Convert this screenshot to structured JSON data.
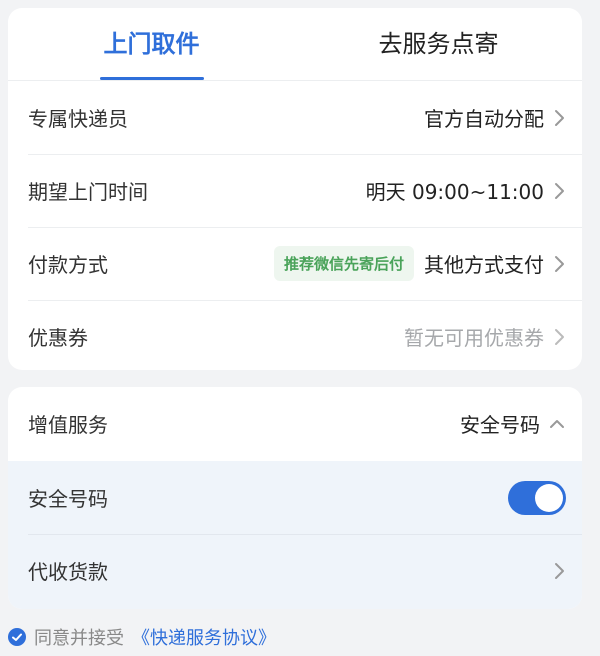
{
  "tabs": [
    {
      "label": "上门取件",
      "active": true
    },
    {
      "label": "去服务点寄",
      "active": false
    }
  ],
  "rows": {
    "courier": {
      "label": "专属快递员",
      "value": "官方自动分配"
    },
    "time": {
      "label": "期望上门时间",
      "value": "明天 09:00~11:00"
    },
    "payment": {
      "label": "付款方式",
      "tag": "推荐微信先寄后付",
      "value": "其他方式支付"
    },
    "coupon": {
      "label": "优惠券",
      "value": "暂无可用优惠券"
    }
  },
  "value_added": {
    "label": "增值服务",
    "value": "安全号码",
    "expanded": true,
    "items": {
      "safe_number": {
        "label": "安全号码",
        "enabled": true
      },
      "cod": {
        "label": "代收货款"
      }
    }
  },
  "agreement": {
    "checked": true,
    "text": "同意并接受",
    "link": "《快递服务协议》"
  },
  "colors": {
    "accent": "#2f6fda",
    "tag_text": "#4aa35a",
    "tag_bg": "#eef6ef",
    "page_bg": "#f2f3f5"
  }
}
